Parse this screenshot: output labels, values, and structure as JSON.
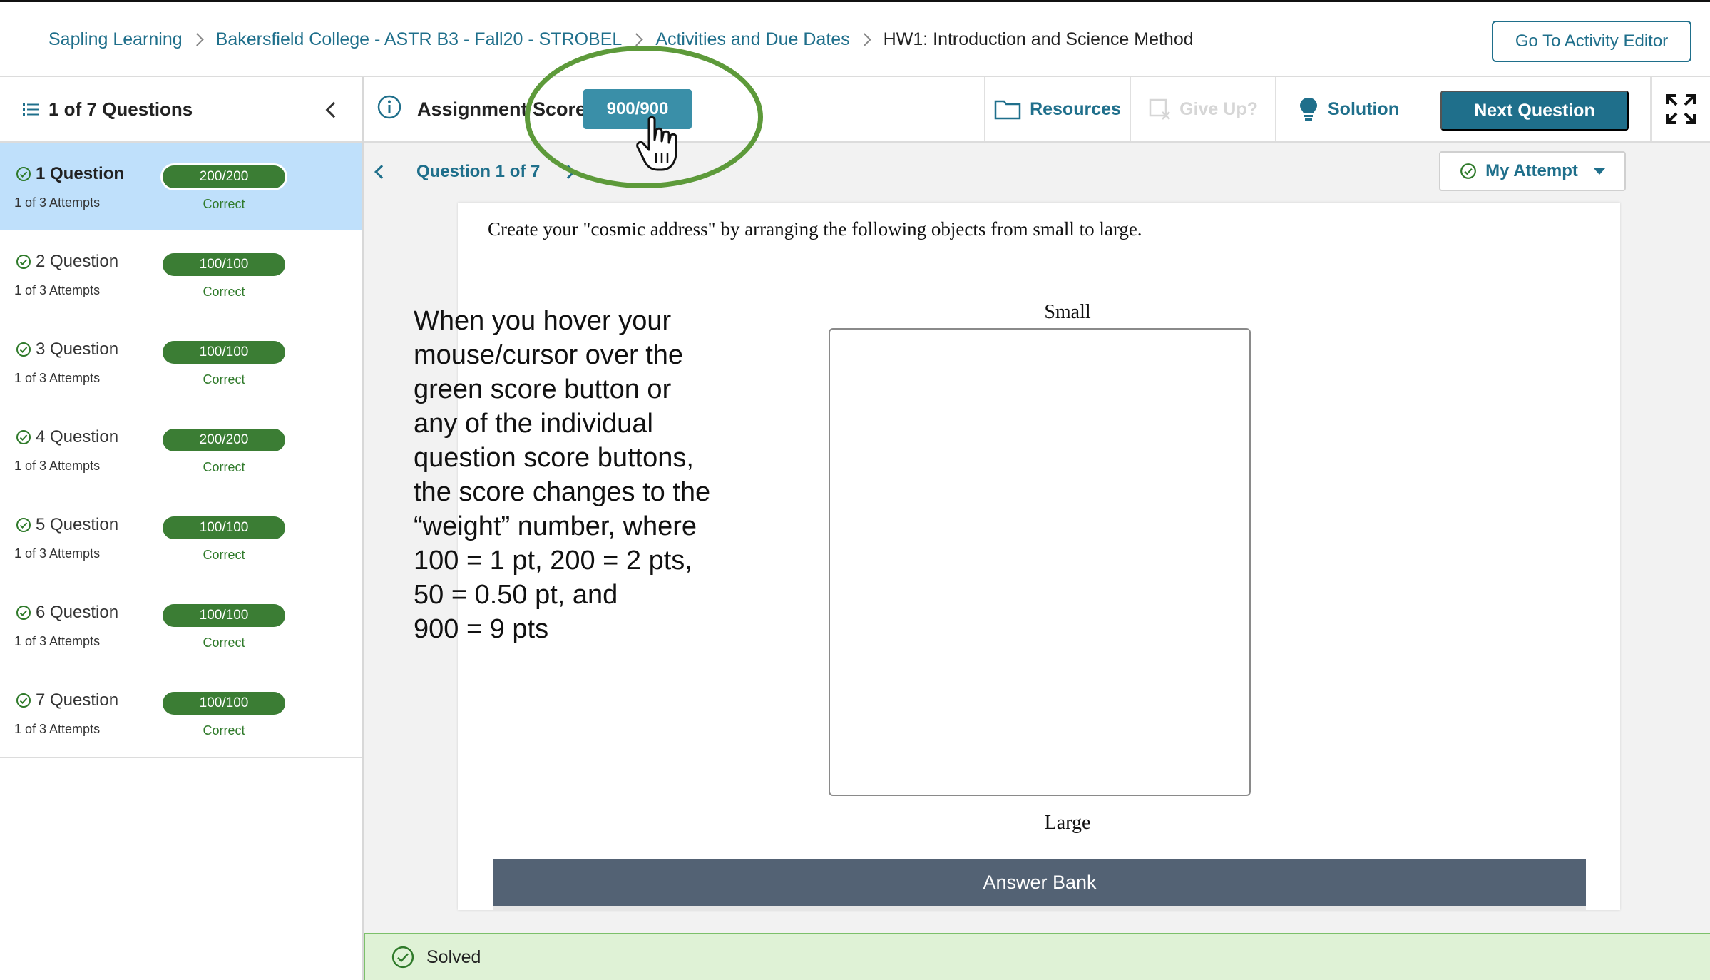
{
  "header": {
    "breadcrumbs": [
      "Sapling Learning",
      "Bakersfield College - ASTR B3 - Fall20 - STROBEL",
      "Activities and Due Dates"
    ],
    "current": "HW1: Introduction and Science Method",
    "editor_button": "Go To Activity Editor"
  },
  "sidebar": {
    "title": "1 of 7 Questions",
    "items": [
      {
        "name": "1 Question",
        "attempts": "1 of 3 Attempts",
        "score": "200/200",
        "status": "Correct"
      },
      {
        "name": "2 Question",
        "attempts": "1 of 3 Attempts",
        "score": "100/100",
        "status": "Correct"
      },
      {
        "name": "3 Question",
        "attempts": "1 of 3 Attempts",
        "score": "100/100",
        "status": "Correct"
      },
      {
        "name": "4 Question",
        "attempts": "1 of 3 Attempts",
        "score": "200/200",
        "status": "Correct"
      },
      {
        "name": "5 Question",
        "attempts": "1 of 3 Attempts",
        "score": "100/100",
        "status": "Correct"
      },
      {
        "name": "6 Question",
        "attempts": "1 of 3 Attempts",
        "score": "100/100",
        "status": "Correct"
      },
      {
        "name": "7 Question",
        "attempts": "1 of 3 Attempts",
        "score": "100/100",
        "status": "Correct"
      }
    ]
  },
  "toolbar": {
    "assignment_label": "Assignment Score:",
    "assignment_score": "900/900",
    "resources": "Resources",
    "give_up": "Give Up?",
    "solution": "Solution",
    "next": "Next Question"
  },
  "question": {
    "nav_label": "Question 1 of 7",
    "attempt_menu": "My Attempt",
    "prompt": "Create your \"cosmic address\" by arranging the following objects from small to large.",
    "small_label": "Small",
    "large_label": "Large",
    "answer_bank": "Answer Bank"
  },
  "annotation": {
    "lines": [
      "When you hover your",
      "mouse/cursor over the",
      "green score button or",
      "any of the individual",
      "question score buttons,",
      "the score changes to the",
      "“weight” number, where",
      "100 = 1 pt, 200 = 2 pts,",
      "50 = 0.50 pt, and",
      "900 = 9 pts"
    ]
  },
  "footer": {
    "status": "Solved"
  },
  "colors": {
    "accent": "#1f6f8b",
    "score_green": "#3b7d34",
    "score_button": "#3a8fa8",
    "active_row": "#bfe0fb",
    "solved_bg": "#dff2d6",
    "ring": "#5d9a3a"
  },
  "icons": [
    "list-icon",
    "chevron-left-icon",
    "info-icon",
    "folder-icon",
    "give-up-icon",
    "lightbulb-icon",
    "fullscreen-icon",
    "check-circle-icon",
    "caret-down-icon",
    "hand-cursor-icon"
  ]
}
